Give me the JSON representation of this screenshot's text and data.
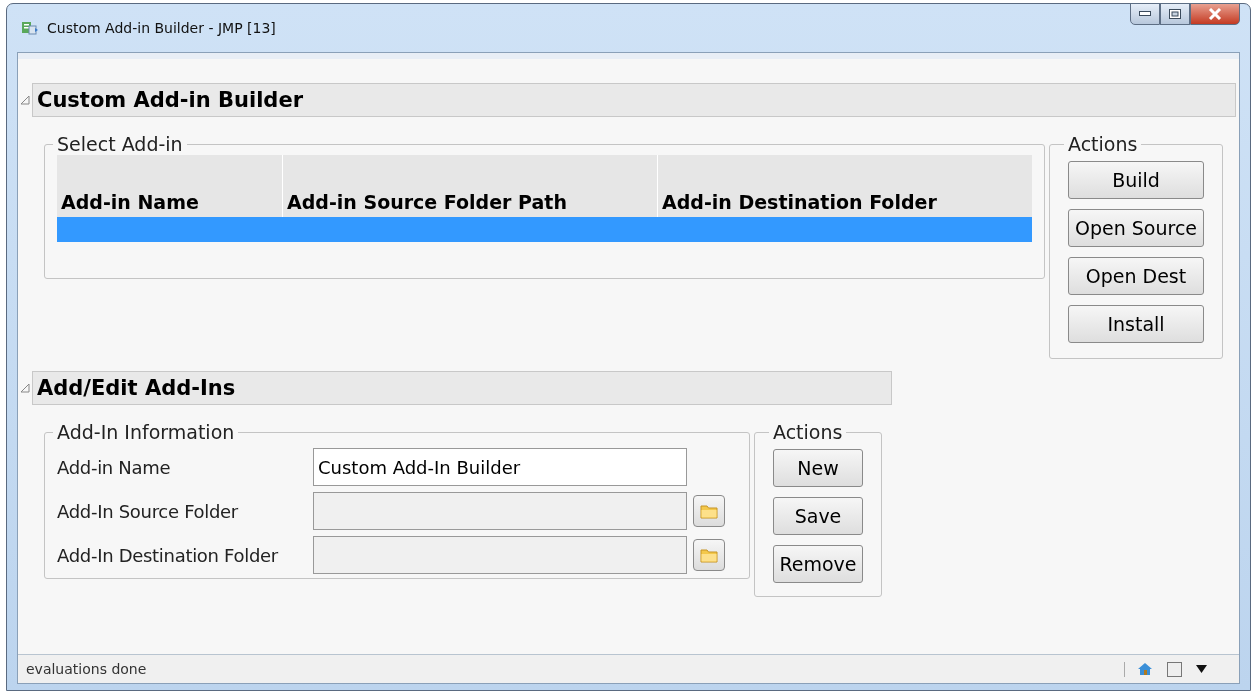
{
  "window": {
    "title": "Custom Add-in Builder - JMP [13]"
  },
  "outlines": [
    {
      "title": "Custom Add-in Builder",
      "expanded": true,
      "kind": "builder",
      "group": {
        "title": "Select Add-in",
        "table": {
          "columns": [
            "Add-in Name",
            "Add-in Source Folder Path",
            "Add-in Destination Folder"
          ],
          "rows": [
            {
              "selected": true
            }
          ]
        }
      },
      "actions": {
        "title": "Actions",
        "buttons": [
          "Build",
          "Open Source",
          "Open Dest",
          "Install"
        ]
      }
    },
    {
      "title": "Add/Edit Add-Ins",
      "expanded": true,
      "kind": "editor",
      "group": {
        "title": "Add-In Information",
        "fields": [
          {
            "label": "Add-in Name",
            "kind": "text",
            "value": "Custom Add-In Builder"
          },
          {
            "label": "Add-In Source Folder",
            "kind": "folder"
          },
          {
            "label": "Add-In Destination Folder",
            "kind": "folder"
          }
        ]
      },
      "actions": {
        "title": "Actions",
        "buttons": [
          "New",
          "Save",
          "Remove"
        ]
      }
    }
  ],
  "status_bar": {
    "text": "evaluations done"
  }
}
